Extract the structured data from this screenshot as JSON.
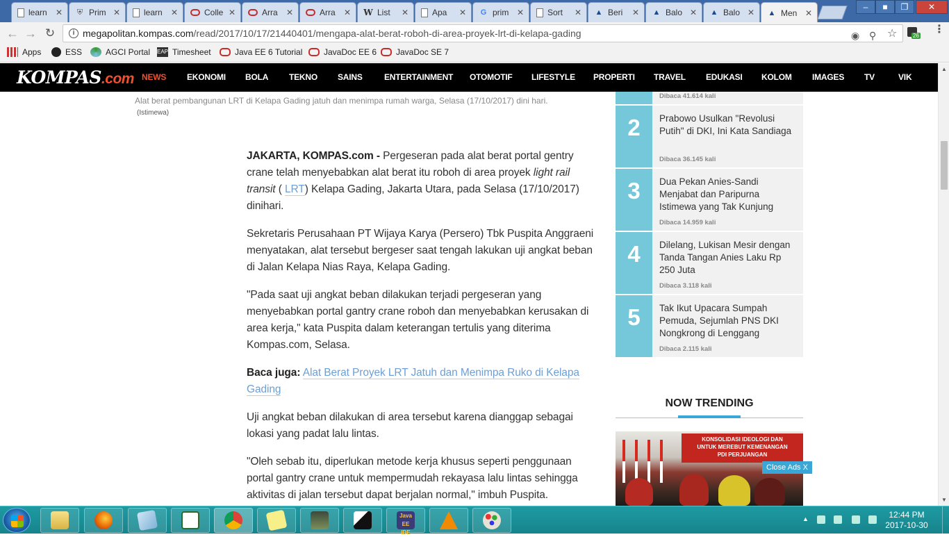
{
  "browser": {
    "tabs": [
      {
        "icon": "document-icon",
        "title": "learn"
      },
      {
        "icon": "shield-icon",
        "title": "Prim"
      },
      {
        "icon": "document-icon",
        "title": "learn"
      },
      {
        "icon": "oracle-icon",
        "title": "Colle"
      },
      {
        "icon": "oracle-icon",
        "title": "Arra"
      },
      {
        "icon": "oracle-icon",
        "title": "Arra"
      },
      {
        "icon": "wikipedia-icon",
        "title": "List"
      },
      {
        "icon": "document-icon",
        "title": "Apa"
      },
      {
        "icon": "google-icon",
        "title": "prim"
      },
      {
        "icon": "document-icon",
        "title": "Sort"
      },
      {
        "icon": "kompas-icon",
        "title": "Beri"
      },
      {
        "icon": "kompas-icon",
        "title": "Balo"
      },
      {
        "icon": "kompas-icon",
        "title": "Balo"
      },
      {
        "icon": "kompas-icon",
        "title": "Men",
        "active": true
      }
    ],
    "url_host": "megapolitan.kompas.com",
    "url_path": "/read/2017/10/17/21440401/mengapa-alat-berat-roboh-di-area-proyek-lrt-di-kelapa-gading",
    "extension_badge": "26",
    "bookmarks": [
      {
        "icon": "apps-grid-icon",
        "label": "Apps"
      },
      {
        "icon": "ess-icon",
        "label": "ESS"
      },
      {
        "icon": "agci-icon",
        "label": "AGCI Portal"
      },
      {
        "icon": "eap-icon",
        "label": "Timesheet"
      },
      {
        "icon": "oracle-icon",
        "label": "Java EE 6 Tutorial"
      },
      {
        "icon": "oracle-icon",
        "label": "JavaDoc EE 6"
      },
      {
        "icon": "oracle-icon",
        "label": "JavaDoc SE 7"
      }
    ]
  },
  "site": {
    "logo_text": "KOMPAS",
    "logo_suffix": ".com",
    "nav": [
      "NEWS",
      "EKONOMI",
      "BOLA",
      "TEKNO",
      "SAINS",
      "ENTERTAINMENT",
      "OTOMOTIF",
      "LIFESTYLE",
      "PROPERTI",
      "TRAVEL",
      "EDUKASI",
      "KOLOM",
      "IMAGES",
      "TV",
      "VIK"
    ],
    "active_nav": "NEWS"
  },
  "article": {
    "caption": "Alat berat pembangunan LRT di Kelapa Gading jatuh dan menimpa rumah warga, Selasa (17/10/2017) dini hari.",
    "credit": "(Istimewa)",
    "lead_dateline": "JAKARTA, KOMPAS.com -",
    "p1_a": " Pergeseran pada alat berat portal gentry crane telah menyebabkan alat berat itu roboh di area proyek ",
    "p1_italic": "light rail transit",
    "p1_b": " ( ",
    "p1_link": "LRT",
    "p1_c": ") Kelapa Gading, Jakarta Utara, pada Selasa (17/10/2017) dinihari.",
    "p2": "Sekretaris Perusahaan PT Wijaya Karya (Persero) Tbk Puspita Anggraeni menyatakan, alat tersebut bergeser saat tengah lakukan uji angkat beban di Jalan Kelapa Nias Raya, Kelapa Gading.",
    "p3": "\"Pada saat uji angkat beban dilakukan terjadi pergeseran yang menyebabkan portal gantry crane roboh dan menyebabkan kerusakan di area kerja,\" kata Puspita dalam keterangan tertulis yang diterima Kompas.com, Selasa.",
    "baca_label": "Baca juga:",
    "baca_link": "Alat Berat Proyek LRT Jatuh dan Menimpa Ruko di Kelapa Gading",
    "p4": "Uji angkat beban dilakukan di area tersebut karena dianggap sebagai lokasi yang padat lalu lintas.",
    "p5": "\"Oleh sebab itu, diperlukan metode kerja khusus seperti penggunaan portal gantry crane untuk mempermudah rekayasa lalu lintas sehingga aktivitas di jalan tersebut dapat berjalan normal,\" imbuh Puspita."
  },
  "popular": {
    "top_read": "Dibaca 41.614 kali",
    "items": [
      {
        "rank": "2",
        "title": "Prabowo Usulkan \"Revolusi Putih\" di DKI, Ini Kata Sandiaga",
        "reads": "Dibaca 36.145 kali"
      },
      {
        "rank": "3",
        "title": "Dua Pekan Anies-Sandi Menjabat dan Paripurna Istimewa yang Tak Kunjung",
        "reads": "Dibaca 14.959 kali"
      },
      {
        "rank": "4",
        "title": "Dilelang, Lukisan Mesir dengan Tanda Tangan Anies Laku Rp 250 Juta",
        "reads": "Dibaca 3.118 kali"
      },
      {
        "rank": "5",
        "title": "Tak Ikut Upacara Sumpah Pemuda, Sejumlah PNS DKI Nongkrong di Lenggang",
        "reads": "Dibaca 2.115 kali"
      }
    ]
  },
  "trending": {
    "title": "NOW TRENDING",
    "banner_line1": "KONSOLIDASI IDEOLOGI DAN",
    "banner_line2": "UNTUK MEREBUT KEMENANGAN",
    "banner_line3": "PDI PERJUANGAN",
    "close_ads": "Close Ads X"
  },
  "taskbar": {
    "apps": [
      "file-explorer-icon",
      "firefox-icon",
      "notepad-icon",
      "chart-app-icon",
      "chrome-icon",
      "sticky-notes-icon",
      "network-tool-icon",
      "photo-app-icon",
      "java-ee-ide-icon",
      "vlc-icon",
      "paint-icon"
    ],
    "java_label": "Java EE IDE",
    "time": "12:44 PM",
    "date": "2017-10-30"
  },
  "colors": {
    "kompas_orange": "#f0502d",
    "popular_rank_bg": "#74c8d9",
    "trending_accent": "#3aa7d6",
    "link": "#6d9fd4"
  }
}
